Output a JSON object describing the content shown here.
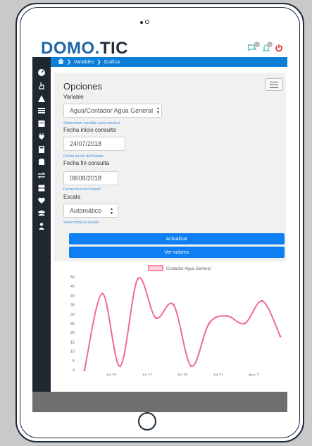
{
  "app": {
    "logo_part1": "DOMO.",
    "logo_part2": "TIC"
  },
  "header_icons": [
    "flag-icon",
    "bell-icon",
    "power-icon"
  ],
  "sidebar": {
    "icons": [
      "dashboard-icon",
      "hand-pointer-icon",
      "warning-icon",
      "list-icon",
      "calendar-icon",
      "plug-icon",
      "calculator-icon",
      "database-icon",
      "exchange-icon",
      "server-icon",
      "heart-icon",
      "users-icon",
      "user-icon"
    ]
  },
  "breadcrumb": {
    "items": [
      "Variables",
      "Gráfica"
    ]
  },
  "panel": {
    "title": "Opciones",
    "variable_label": "Variable",
    "variable_value": "Agua/Contador Agua General",
    "variable_hint": "Seleccione variable para mostrar",
    "start_label": "Fecha inicio consulta",
    "start_value": "24/07/2018",
    "start_hint": "Fecha inicial del listado",
    "end_label": "Fecha fin consulta",
    "end_value": "08/08/2018",
    "end_hint": "Fecha final del listado",
    "scale_label": "Escala",
    "scale_value": "Automático",
    "scale_hint": "Seleccione la escala",
    "update_button": "Actualizar",
    "view_button": "Ver valores"
  },
  "colors": {
    "accent": "#0d7ff2",
    "sidebar": "#1f2730",
    "line": "#f06b8f",
    "logo_blue": "#1e66a6"
  },
  "chart_data": {
    "type": "line",
    "title": "",
    "xlabel": "",
    "ylabel": "",
    "ylim": [
      0,
      50
    ],
    "yticks": [
      0,
      5,
      10,
      15,
      20,
      25,
      30,
      35,
      40,
      45,
      50
    ],
    "xtick_labels": [
      "Jul 25",
      "Jul 27",
      "Jul 29",
      "Jul 31",
      "Aug 2"
    ],
    "xtick_positions": [
      1.5,
      3.5,
      5.5,
      7.5,
      9.5
    ],
    "series": [
      {
        "name": "Contador Agua General",
        "x": [
          0,
          1,
          2,
          3,
          4,
          5,
          6,
          7,
          8,
          9,
          10,
          11
        ],
        "values": [
          0,
          41,
          2,
          49,
          28,
          35,
          2,
          25,
          29,
          25,
          37,
          18
        ]
      }
    ],
    "grid": false,
    "legend": "top-center"
  }
}
